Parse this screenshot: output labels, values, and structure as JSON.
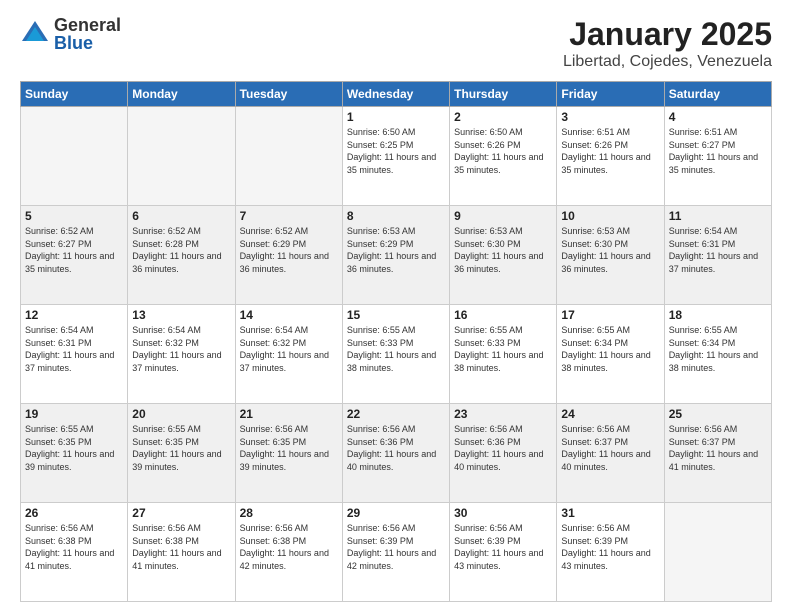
{
  "header": {
    "logo_general": "General",
    "logo_blue": "Blue",
    "month_title": "January 2025",
    "location": "Libertad, Cojedes, Venezuela"
  },
  "weekdays": [
    "Sunday",
    "Monday",
    "Tuesday",
    "Wednesday",
    "Thursday",
    "Friday",
    "Saturday"
  ],
  "weeks": [
    [
      {
        "day": "",
        "sunrise": "",
        "sunset": "",
        "daylight": "",
        "empty": true
      },
      {
        "day": "",
        "sunrise": "",
        "sunset": "",
        "daylight": "",
        "empty": true
      },
      {
        "day": "",
        "sunrise": "",
        "sunset": "",
        "daylight": "",
        "empty": true
      },
      {
        "day": "1",
        "sunrise": "Sunrise: 6:50 AM",
        "sunset": "Sunset: 6:25 PM",
        "daylight": "Daylight: 11 hours and 35 minutes.",
        "empty": false
      },
      {
        "day": "2",
        "sunrise": "Sunrise: 6:50 AM",
        "sunset": "Sunset: 6:26 PM",
        "daylight": "Daylight: 11 hours and 35 minutes.",
        "empty": false
      },
      {
        "day": "3",
        "sunrise": "Sunrise: 6:51 AM",
        "sunset": "Sunset: 6:26 PM",
        "daylight": "Daylight: 11 hours and 35 minutes.",
        "empty": false
      },
      {
        "day": "4",
        "sunrise": "Sunrise: 6:51 AM",
        "sunset": "Sunset: 6:27 PM",
        "daylight": "Daylight: 11 hours and 35 minutes.",
        "empty": false
      }
    ],
    [
      {
        "day": "5",
        "sunrise": "Sunrise: 6:52 AM",
        "sunset": "Sunset: 6:27 PM",
        "daylight": "Daylight: 11 hours and 35 minutes.",
        "empty": false
      },
      {
        "day": "6",
        "sunrise": "Sunrise: 6:52 AM",
        "sunset": "Sunset: 6:28 PM",
        "daylight": "Daylight: 11 hours and 36 minutes.",
        "empty": false
      },
      {
        "day": "7",
        "sunrise": "Sunrise: 6:52 AM",
        "sunset": "Sunset: 6:29 PM",
        "daylight": "Daylight: 11 hours and 36 minutes.",
        "empty": false
      },
      {
        "day": "8",
        "sunrise": "Sunrise: 6:53 AM",
        "sunset": "Sunset: 6:29 PM",
        "daylight": "Daylight: 11 hours and 36 minutes.",
        "empty": false
      },
      {
        "day": "9",
        "sunrise": "Sunrise: 6:53 AM",
        "sunset": "Sunset: 6:30 PM",
        "daylight": "Daylight: 11 hours and 36 minutes.",
        "empty": false
      },
      {
        "day": "10",
        "sunrise": "Sunrise: 6:53 AM",
        "sunset": "Sunset: 6:30 PM",
        "daylight": "Daylight: 11 hours and 36 minutes.",
        "empty": false
      },
      {
        "day": "11",
        "sunrise": "Sunrise: 6:54 AM",
        "sunset": "Sunset: 6:31 PM",
        "daylight": "Daylight: 11 hours and 37 minutes.",
        "empty": false
      }
    ],
    [
      {
        "day": "12",
        "sunrise": "Sunrise: 6:54 AM",
        "sunset": "Sunset: 6:31 PM",
        "daylight": "Daylight: 11 hours and 37 minutes.",
        "empty": false
      },
      {
        "day": "13",
        "sunrise": "Sunrise: 6:54 AM",
        "sunset": "Sunset: 6:32 PM",
        "daylight": "Daylight: 11 hours and 37 minutes.",
        "empty": false
      },
      {
        "day": "14",
        "sunrise": "Sunrise: 6:54 AM",
        "sunset": "Sunset: 6:32 PM",
        "daylight": "Daylight: 11 hours and 37 minutes.",
        "empty": false
      },
      {
        "day": "15",
        "sunrise": "Sunrise: 6:55 AM",
        "sunset": "Sunset: 6:33 PM",
        "daylight": "Daylight: 11 hours and 38 minutes.",
        "empty": false
      },
      {
        "day": "16",
        "sunrise": "Sunrise: 6:55 AM",
        "sunset": "Sunset: 6:33 PM",
        "daylight": "Daylight: 11 hours and 38 minutes.",
        "empty": false
      },
      {
        "day": "17",
        "sunrise": "Sunrise: 6:55 AM",
        "sunset": "Sunset: 6:34 PM",
        "daylight": "Daylight: 11 hours and 38 minutes.",
        "empty": false
      },
      {
        "day": "18",
        "sunrise": "Sunrise: 6:55 AM",
        "sunset": "Sunset: 6:34 PM",
        "daylight": "Daylight: 11 hours and 38 minutes.",
        "empty": false
      }
    ],
    [
      {
        "day": "19",
        "sunrise": "Sunrise: 6:55 AM",
        "sunset": "Sunset: 6:35 PM",
        "daylight": "Daylight: 11 hours and 39 minutes.",
        "empty": false
      },
      {
        "day": "20",
        "sunrise": "Sunrise: 6:55 AM",
        "sunset": "Sunset: 6:35 PM",
        "daylight": "Daylight: 11 hours and 39 minutes.",
        "empty": false
      },
      {
        "day": "21",
        "sunrise": "Sunrise: 6:56 AM",
        "sunset": "Sunset: 6:35 PM",
        "daylight": "Daylight: 11 hours and 39 minutes.",
        "empty": false
      },
      {
        "day": "22",
        "sunrise": "Sunrise: 6:56 AM",
        "sunset": "Sunset: 6:36 PM",
        "daylight": "Daylight: 11 hours and 40 minutes.",
        "empty": false
      },
      {
        "day": "23",
        "sunrise": "Sunrise: 6:56 AM",
        "sunset": "Sunset: 6:36 PM",
        "daylight": "Daylight: 11 hours and 40 minutes.",
        "empty": false
      },
      {
        "day": "24",
        "sunrise": "Sunrise: 6:56 AM",
        "sunset": "Sunset: 6:37 PM",
        "daylight": "Daylight: 11 hours and 40 minutes.",
        "empty": false
      },
      {
        "day": "25",
        "sunrise": "Sunrise: 6:56 AM",
        "sunset": "Sunset: 6:37 PM",
        "daylight": "Daylight: 11 hours and 41 minutes.",
        "empty": false
      }
    ],
    [
      {
        "day": "26",
        "sunrise": "Sunrise: 6:56 AM",
        "sunset": "Sunset: 6:38 PM",
        "daylight": "Daylight: 11 hours and 41 minutes.",
        "empty": false
      },
      {
        "day": "27",
        "sunrise": "Sunrise: 6:56 AM",
        "sunset": "Sunset: 6:38 PM",
        "daylight": "Daylight: 11 hours and 41 minutes.",
        "empty": false
      },
      {
        "day": "28",
        "sunrise": "Sunrise: 6:56 AM",
        "sunset": "Sunset: 6:38 PM",
        "daylight": "Daylight: 11 hours and 42 minutes.",
        "empty": false
      },
      {
        "day": "29",
        "sunrise": "Sunrise: 6:56 AM",
        "sunset": "Sunset: 6:39 PM",
        "daylight": "Daylight: 11 hours and 42 minutes.",
        "empty": false
      },
      {
        "day": "30",
        "sunrise": "Sunrise: 6:56 AM",
        "sunset": "Sunset: 6:39 PM",
        "daylight": "Daylight: 11 hours and 43 minutes.",
        "empty": false
      },
      {
        "day": "31",
        "sunrise": "Sunrise: 6:56 AM",
        "sunset": "Sunset: 6:39 PM",
        "daylight": "Daylight: 11 hours and 43 minutes.",
        "empty": false
      },
      {
        "day": "",
        "sunrise": "",
        "sunset": "",
        "daylight": "",
        "empty": true
      }
    ]
  ]
}
